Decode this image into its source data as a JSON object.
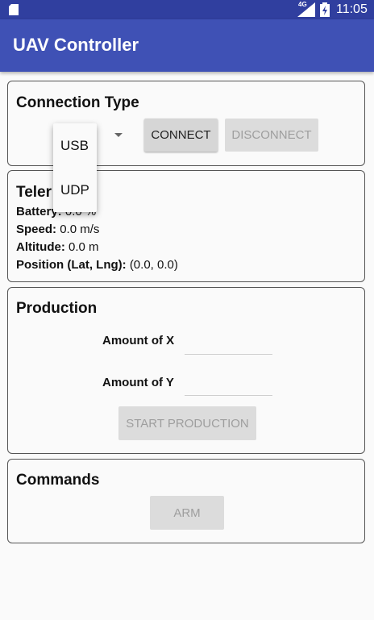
{
  "status_bar": {
    "network": "4G",
    "time": "11:05",
    "icons": [
      "sd-card-icon",
      "signal-icon",
      "battery-charging-icon"
    ]
  },
  "app_bar": {
    "title": "UAV Controller"
  },
  "connection": {
    "title": "Connection Type",
    "connect_label": "CONNECT",
    "disconnect_label": "DISCONNECT",
    "spinner_icon": "dropdown-arrow-icon",
    "dropdown_options": [
      "USB",
      "UDP"
    ]
  },
  "telemetry": {
    "title": "Telemetry",
    "visible_title": "Teler",
    "battery_label": "Battery:",
    "battery_value": "0.0 %",
    "speed_label": "Speed:",
    "speed_value": "0.0 m/s",
    "altitude_label": "Altitude:",
    "altitude_value": "0.0 m",
    "position_label": "Position (Lat, Lng):",
    "position_value": "(0.0, 0.0)"
  },
  "production": {
    "title": "Production",
    "amount_x_label": "Amount of X",
    "amount_x_value": "",
    "amount_y_label": "Amount of Y",
    "amount_y_value": "",
    "start_label": "START PRODUCTION"
  },
  "commands": {
    "title": "Commands",
    "arm_label": "ARM"
  },
  "colors": {
    "status_bar": "#303f9f",
    "app_bar": "#3f51b5",
    "background": "#fafafa",
    "button_enabled": "#d6d6d6",
    "button_disabled_text": "#9e9e9e"
  }
}
